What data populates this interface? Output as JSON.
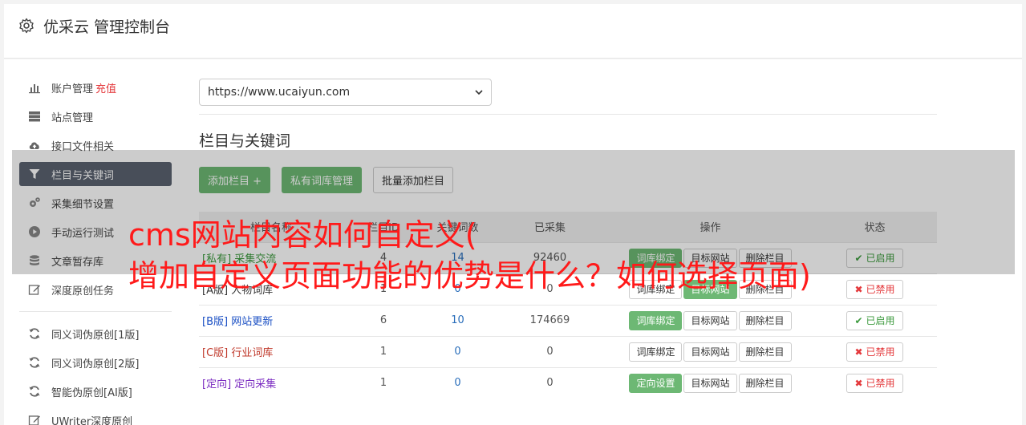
{
  "header": {
    "title": "优采云 管理控制台",
    "icon": "gear-icon"
  },
  "sidebar": {
    "items": [
      {
        "label": "账户管理",
        "badge": "充值",
        "icon": "bar-chart-icon"
      },
      {
        "label": "站点管理",
        "icon": "server-icon"
      },
      {
        "label": "接口文件相关",
        "icon": "cloud-upload-icon"
      },
      {
        "label": "栏目与关键词",
        "icon": "filter-icon",
        "active": true
      },
      {
        "label": "采集细节设置",
        "icon": "cogs-icon"
      },
      {
        "label": "手动运行测试",
        "icon": "play-circle-icon"
      },
      {
        "label": "文章暂存库",
        "icon": "database-icon"
      },
      {
        "label": "深度原创任务",
        "icon": "edit-icon"
      }
    ],
    "items2": [
      {
        "label": "同义词伪原创[1版]",
        "icon": "refresh-icon"
      },
      {
        "label": "同义词伪原创[2版]",
        "icon": "refresh-icon"
      },
      {
        "label": "智能伪原创[AI版]",
        "icon": "refresh-icon"
      },
      {
        "label": "UWriter深度原创",
        "icon": "edit-icon"
      }
    ]
  },
  "site_select": {
    "value": "https://www.ucaiyun.com"
  },
  "section": {
    "title": "栏目与关键词"
  },
  "buttons": {
    "add_column": "添加栏目 +",
    "private_lib": "私有词库管理",
    "batch_add": "批量添加栏目"
  },
  "table": {
    "headers": [
      "栏目名称",
      "栏目ID",
      "关键词数",
      "已采集",
      "操作",
      "状态"
    ],
    "rows": [
      {
        "tag": "[私有]",
        "name": "采集交流",
        "a": "4",
        "b": "14",
        "c": "92460",
        "op1": "词库绑定",
        "op1_green": true,
        "op2": "目标网站",
        "op3": "删除栏目",
        "status": "已启用",
        "on": true,
        "color": "#3c9a3e"
      },
      {
        "tag": "[A版]",
        "name": "人物词库",
        "a": "1",
        "b": "0",
        "c": "0",
        "op1": "词库绑定",
        "op1_green": false,
        "op2": "目标网站",
        "op2_green": true,
        "op3": "删除栏目",
        "status": "已禁用",
        "on": false,
        "color": "#333333"
      },
      {
        "tag": "[B版]",
        "name": "网站更新",
        "a": "6",
        "b": "10",
        "c": "174669",
        "op1": "词库绑定",
        "op1_green": true,
        "op2": "目标网站",
        "op3": "删除栏目",
        "status": "已启用",
        "on": true,
        "color": "#1a4fc4"
      },
      {
        "tag": "[C版]",
        "name": "行业词库",
        "a": "1",
        "b": "0",
        "c": "0",
        "op1": "词库绑定",
        "op1_green": false,
        "op2": "目标网站",
        "op3": "删除栏目",
        "status": "已禁用",
        "on": false,
        "color": "#c0392b"
      },
      {
        "tag": "[定向]",
        "name": "定向采集",
        "a": "1",
        "b": "0",
        "c": "0",
        "op1": "定向设置",
        "op1_green": true,
        "op2": "目标网站",
        "op3": "删除栏目",
        "status": "已禁用",
        "on": false,
        "color": "#7b2cc1"
      }
    ]
  },
  "overlay": {
    "line1": "cms网站内容如何自定义(",
    "line2": "增加自定义页面功能的优势是什么？如何选择页面)"
  }
}
